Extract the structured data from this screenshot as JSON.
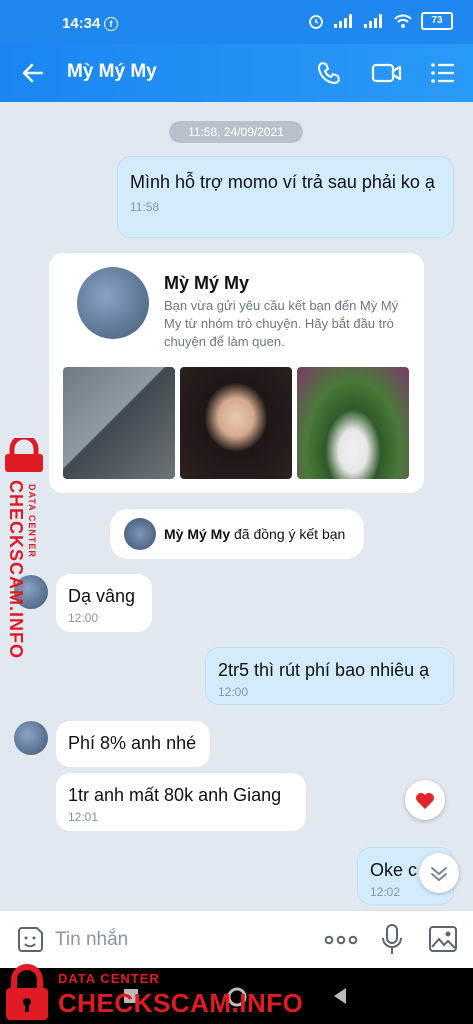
{
  "status": {
    "time": "14:34",
    "battery": "73"
  },
  "header": {
    "contact_name": "Mỳ Mý My"
  },
  "date_chip": "11:58, 24/09/2021",
  "messages": [
    {
      "text": "Mình hỗ trợ momo ví trả sau phải ko ạ",
      "time": "11:58"
    },
    {
      "text": "Dạ vâng",
      "time": "12:00"
    },
    {
      "text": "2tr5 thì rút phí bao nhiêu ạ",
      "time": "12:00"
    },
    {
      "text": "Phí 8% anh nhé",
      "time": ""
    },
    {
      "text": "1tr anh mất 80k anh Giang",
      "time": "12:01"
    },
    {
      "text": "Oke c",
      "time": "12:02"
    }
  ],
  "friend_card": {
    "name": "Mỳ Mý My",
    "description": "Bạn vừa gửi yêu cầu kết bạn đến Mỳ Mý My từ nhóm trò chuyện. Hãy bắt đầu trò chuyện để làm quen."
  },
  "notice": {
    "name": "Mỳ Mý My",
    "text": " đã đồng ý kết bạn"
  },
  "composer": {
    "placeholder": "Tin nhắn"
  },
  "watermark": {
    "line1": "DATA CENTER",
    "line2": "CHECKSCAM.INFO"
  },
  "colors": {
    "header": "#1e88f0",
    "outgoing": "#d3ecfd",
    "background": "#e2e8ef",
    "watermark": "#e01b24"
  },
  "icons": [
    "back-arrow-icon",
    "phone-icon",
    "video-camera-icon",
    "menu-list-icon",
    "sticker-icon",
    "more-dots-icon",
    "microphone-icon",
    "image-icon",
    "heart-icon",
    "chevron-down-icon",
    "lock-icon"
  ]
}
